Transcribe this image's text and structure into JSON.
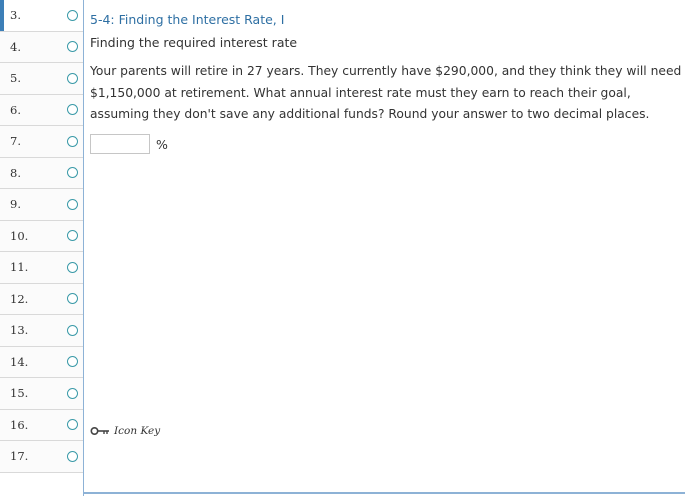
{
  "nav": {
    "items": [
      {
        "label": "3.",
        "active": true
      },
      {
        "label": "4."
      },
      {
        "label": "5."
      },
      {
        "label": "6."
      },
      {
        "label": "7."
      },
      {
        "label": "8."
      },
      {
        "label": "9."
      },
      {
        "label": "10."
      },
      {
        "label": "11."
      },
      {
        "label": "12."
      },
      {
        "label": "13."
      },
      {
        "label": "14."
      },
      {
        "label": "15."
      },
      {
        "label": "16."
      },
      {
        "label": "17."
      }
    ]
  },
  "question": {
    "title": "5-4: Finding the Interest Rate, I",
    "subtitle": "Finding the required interest rate",
    "body": "Your parents will retire in 27 years. They currently have $290,000, and they think they will need $1,150,000 at retirement. What annual interest rate must they earn to reach their goal, assuming they don't save any additional funds? Round your answer to two decimal places.",
    "answer_value": "",
    "unit": "%"
  },
  "icon_key": {
    "label": "Icon Key",
    "icon": "key-icon"
  },
  "colors": {
    "title": "#2e6fa3",
    "accent": "#3d7fb8",
    "circle": "#3a9aa8",
    "divider": "#8db2d6"
  }
}
